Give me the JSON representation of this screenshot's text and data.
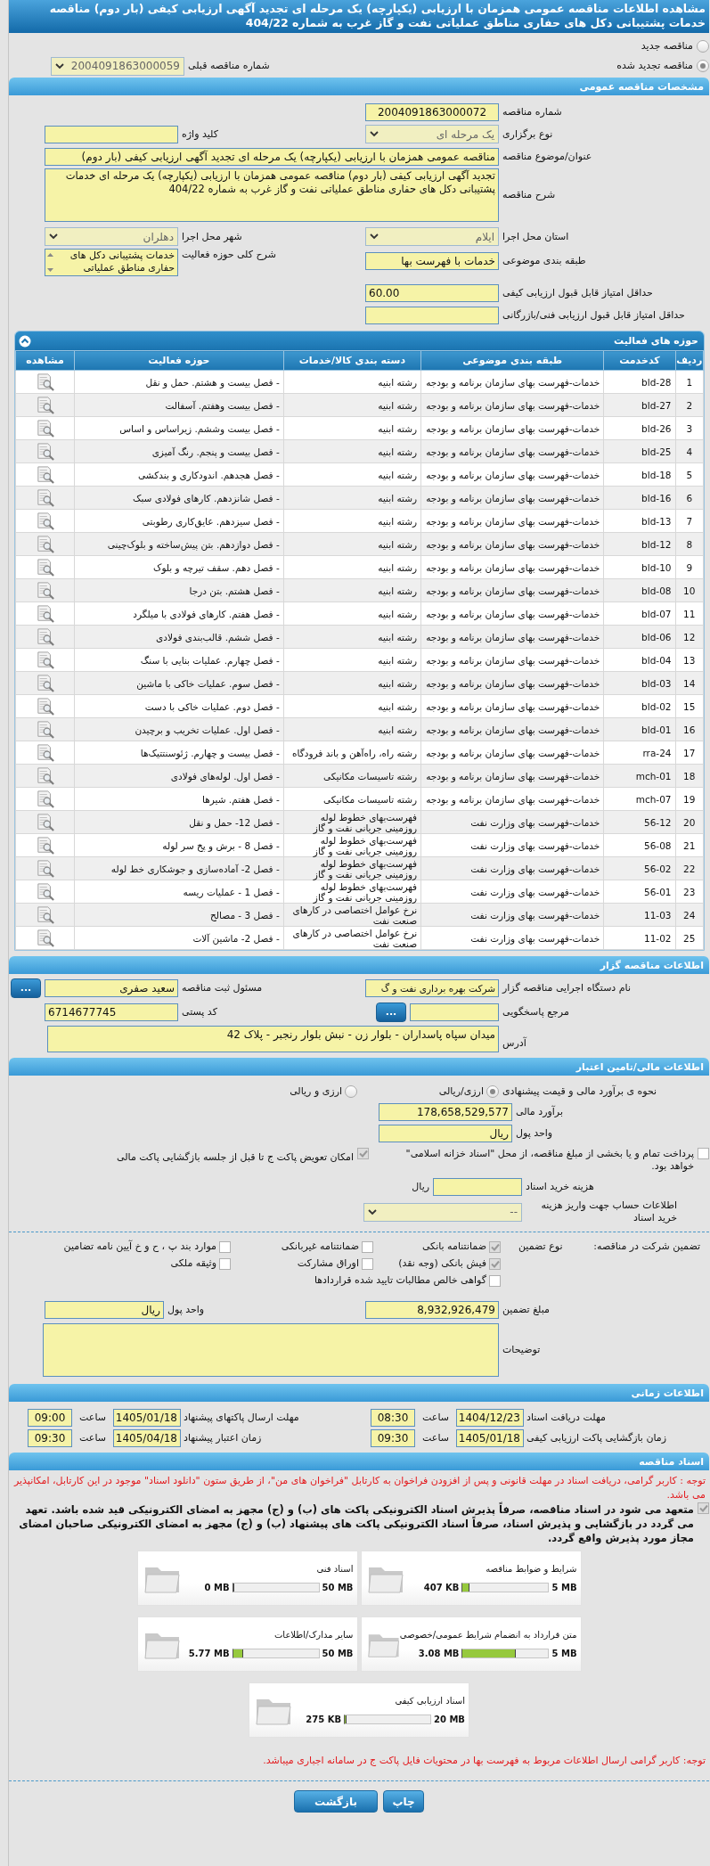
{
  "header": {
    "title": "مشاهده اطلاعات مناقصه عمومی همزمان با ارزیابی (یکپارچه) یک مرحله ای تجدید آگهی ارزیابی کیفی (بار دوم) مناقصه خدمات پشتیبانی دکل های حفاری مناطق عملیاتی نفت و گاز غرب به شماره 404/22"
  },
  "tender_type": [
    {
      "label": "مناقصه جدید",
      "selected": false
    },
    {
      "label": "مناقصه تجدید شده",
      "selected": true
    }
  ],
  "previous_tender": {
    "label": "شماره مناقصه قبلی",
    "value": "2004091863000059"
  },
  "general": {
    "title": "مشخصات مناقصه عمومی",
    "tender_number": {
      "label": "شماره مناقصه",
      "value": "2004091863000072"
    },
    "holding_type": {
      "label": "نوع برگزاری",
      "value": "یک مرحله ای"
    },
    "keyword": {
      "label": "کلید واژه"
    },
    "subject": {
      "label": "عنوان/موضوع مناقصه",
      "value": "مناقصه عمومی همزمان با ارزیابی (یکپارچه) یک مرحله ای تجدید آگهی ارزیابی کیفی (بار دوم)"
    },
    "description": {
      "label": "شرح مناقصه",
      "value": "تجدید آگهی ارزیابی کیفی (بار دوم) مناقصه عمومی همزمان با ارزیابی (یکپارچه) یک مرحله ای خدمات پشتیبانی دکل های حفاری مناطق عملیاتی نفت و گاز غرب به شماره 404/22"
    },
    "province": {
      "label": "استان محل اجرا",
      "value": "ایلام"
    },
    "city": {
      "label": "شهر محل اجرا",
      "value": "دهلران"
    },
    "category": {
      "label": "طبقه بندی موضوعی",
      "value": "خدمات با فهرست بها"
    },
    "activity_scope": {
      "label": "شرح کلی حوزه فعالیت",
      "value": "خدمات پشتیبانی دکل های حفاری مناطق عملیاتی"
    },
    "min_quality_score": {
      "label": "حداقل امتیاز قابل قبول ارزیابی کیفی",
      "value": "60.00"
    },
    "min_technical_score": {
      "label": "حداقل امتیاز قابل قبول ارزیابی فنی/بازرگانی"
    }
  },
  "activities": {
    "title": "حوزه های فعالیت",
    "columns": [
      "ردیف",
      "کدخدمت",
      "طبقه بندی موضوعی",
      "دسته بندی کالا/خدمات",
      "حوزه فعالیت",
      "مشاهده"
    ],
    "rows": [
      {
        "index": "1",
        "code": "bld-28",
        "category": "خدمات-فهرست بهای سازمان برنامه و بودجه",
        "group": "رشته ابنیه",
        "scope": "- فصل بیست و هشتم. حمل و نقل"
      },
      {
        "index": "2",
        "code": "bld-27",
        "category": "خدمات-فهرست بهای سازمان برنامه و بودجه",
        "group": "رشته ابنیه",
        "scope": "- فصل بیست وهفتم. آسفالت"
      },
      {
        "index": "3",
        "code": "bld-26",
        "category": "خدمات-فهرست بهای سازمان برنامه و بودجه",
        "group": "رشته ابنیه",
        "scope": "- فصل بیست وششم. زیراساس و اساس"
      },
      {
        "index": "4",
        "code": "bld-25",
        "category": "خدمات-فهرست بهای سازمان برنامه و بودجه",
        "group": "رشته ابنیه",
        "scope": "- فصل بیست و پنجم. رنگ آمیزی"
      },
      {
        "index": "5",
        "code": "bld-18",
        "category": "خدمات-فهرست بهای سازمان برنامه و بودجه",
        "group": "رشته ابنیه",
        "scope": "- فصل هجدهم. اندودکاری و بندکشی"
      },
      {
        "index": "6",
        "code": "bld-16",
        "category": "خدمات-فهرست بهای سازمان برنامه و بودجه",
        "group": "رشته ابنیه",
        "scope": "- فصل شانزدهم. کارهای فولادی سبک"
      },
      {
        "index": "7",
        "code": "bld-13",
        "category": "خدمات-فهرست بهای سازمان برنامه و بودجه",
        "group": "رشته ابنیه",
        "scope": "- فصل سیزدهم. عایق‌کاری رطوبتی"
      },
      {
        "index": "8",
        "code": "bld-12",
        "category": "خدمات-فهرست بهای سازمان برنامه و بودجه",
        "group": "رشته ابنیه",
        "scope": "- فصل دوازدهم. بتن پیش‌ساخته و بلوک‌چینی"
      },
      {
        "index": "9",
        "code": "bld-10",
        "category": "خدمات-فهرست بهای سازمان برنامه و بودجه",
        "group": "رشته ابنیه",
        "scope": "- فصل دهم. سقف تیرچه و بلوک"
      },
      {
        "index": "10",
        "code": "bld-08",
        "category": "خدمات-فهرست بهای سازمان برنامه و بودجه",
        "group": "رشته ابنیه",
        "scope": "- فصل هشتم. بتن درجا"
      },
      {
        "index": "11",
        "code": "bld-07",
        "category": "خدمات-فهرست بهای سازمان برنامه و بودجه",
        "group": "رشته ابنیه",
        "scope": "- فصل هفتم. کارهای فولادی با میلگرد"
      },
      {
        "index": "12",
        "code": "bld-06",
        "category": "خدمات-فهرست بهای سازمان برنامه و بودجه",
        "group": "رشته ابنیه",
        "scope": "- فصل ششم. قالب‌بندی فولادی"
      },
      {
        "index": "13",
        "code": "bld-04",
        "category": "خدمات-فهرست بهای سازمان برنامه و بودجه",
        "group": "رشته ابنیه",
        "scope": "- فصل چهارم. عملیات بنایی با سنگ"
      },
      {
        "index": "14",
        "code": "bld-03",
        "category": "خدمات-فهرست بهای سازمان برنامه و بودجه",
        "group": "رشته ابنیه",
        "scope": "- فصل سوم. عملیات خاکی با ماشین"
      },
      {
        "index": "15",
        "code": "bld-02",
        "category": "خدمات-فهرست بهای سازمان برنامه و بودجه",
        "group": "رشته ابنیه",
        "scope": "- فصل دوم. عملیات خاکی با دست"
      },
      {
        "index": "16",
        "code": "bld-01",
        "category": "خدمات-فهرست بهای سازمان برنامه و بودجه",
        "group": "رشته ابنیه",
        "scope": "- فصل اول. عملیات تخریب و برچیدن"
      },
      {
        "index": "17",
        "code": "rra-24",
        "category": "خدمات-فهرست بهای سازمان برنامه و بودجه",
        "group": "رشته راه، راه‌آهن و باند فرودگاه",
        "scope": "- فصل بیست و چهارم. ژئوسنتتیک‌ها"
      },
      {
        "index": "18",
        "code": "mch-01",
        "category": "خدمات-فهرست بهای سازمان برنامه و بودجه",
        "group": "رشته تاسیسات مکانیکی",
        "scope": "- فصل اول. لوله‌های فولادی"
      },
      {
        "index": "19",
        "code": "mch-07",
        "category": "خدمات-فهرست بهای سازمان برنامه و بودجه",
        "group": "رشته تاسیسات مکانیکی",
        "scope": "- فصل هفتم. شیرها"
      },
      {
        "index": "20",
        "code": "56-12",
        "category": "خدمات-فهرست بهای وزارت نفت",
        "group": "فهرست‌بهای خطوط لوله روزمینی جریانی نفت و گاز",
        "scope": "- فصل 12- حمل و نقل"
      },
      {
        "index": "21",
        "code": "56-08",
        "category": "خدمات-فهرست بهای وزارت نفت",
        "group": "فهرست‌بهای خطوط لوله روزمینی جریانی نفت و گاز",
        "scope": "- فصل 8 - برش و پخ سر لوله"
      },
      {
        "index": "22",
        "code": "56-02",
        "category": "خدمات-فهرست بهای وزارت نفت",
        "group": "فهرست‌بهای خطوط لوله روزمینی جریانی نفت و گاز",
        "scope": "- فصل 2- آماده‌سازی و جوشکاری خط لوله"
      },
      {
        "index": "23",
        "code": "56-01",
        "category": "خدمات-فهرست بهای وزارت نفت",
        "group": "فهرست‌بهای خطوط لوله روزمینی جریانی نفت و گاز",
        "scope": "- فصل 1 - عملیات ریسه"
      },
      {
        "index": "24",
        "code": "11-03",
        "category": "خدمات-فهرست بهای وزارت نفت",
        "group": "نرخ عوامل اختصاصی در کارهای صنعت نفت",
        "scope": "- فصل 3 - مصالح"
      },
      {
        "index": "25",
        "code": "11-02",
        "category": "خدمات-فهرست بهای وزارت نفت",
        "group": "نرخ عوامل اختصاصی در کارهای صنعت نفت",
        "scope": "- فصل 2- ماشین آلات"
      }
    ]
  },
  "contractor": {
    "title": "اطلاعات مناقصه گزار",
    "organization": {
      "label": "نام دستگاه اجرایی مناقصه گزار",
      "value": "شرکت بهره برداری نفت و گ"
    },
    "registrar": {
      "label": "مسئول ثبت مناقصه",
      "value": "سعید صفری",
      "button": "..."
    },
    "reference": {
      "label": "مرجع پاسخگویی",
      "button": "..."
    },
    "postal_code": {
      "label": "کد پستی",
      "value": "6714677745"
    },
    "address": {
      "label": "آدرس",
      "value": "میدان سپاه پاسداران - بلوار زن - نبش بلوار رنجبر - پلاک 42"
    }
  },
  "financial": {
    "title": "اطلاعات مالی/تامین اعتبار",
    "estimate_mode": {
      "label": "نحوه ی برآورد مالی و قیمت پیشنهادی",
      "options": [
        {
          "label": "ارزی/ریالی",
          "selected": true
        },
        {
          "label": "ارزی و ریالی",
          "selected": false
        }
      ]
    },
    "estimate": {
      "label": "برآورد مالی",
      "value": "178,658,529,577"
    },
    "currency": {
      "label": "واحد پول",
      "value": "ریال"
    },
    "treasury": {
      "label": "پرداخت تمام و یا بخشی از مبلغ مناقصه، از محل \"اسناد خزانه اسلامی\" خواهد بود.",
      "checked": false
    },
    "envelope_swap": {
      "label": "امکان تعویض پاکت ج تا قبل از جلسه بازگشایی پاکت مالی",
      "checked": true
    },
    "document_fee": {
      "label": "هزینه خرید اسناد",
      "unit": "ریال"
    },
    "account": {
      "label": "اطلاعات حساب جهت واریز هزینه خرید اسناد",
      "value": "--"
    }
  },
  "guarantee": {
    "label": "تضمین شرکت در مناقصه:",
    "type_label": "نوع تضمین",
    "options": [
      {
        "label": "ضمانتنامه بانکی",
        "checked": true
      },
      {
        "label": "ضمانتنامه غیربانکی",
        "checked": false
      },
      {
        "label": "موارد بند پ ، ح و خ آیین نامه تضامین",
        "checked": false
      },
      {
        "label": "فیش بانکی (وجه نقد)",
        "checked": true
      },
      {
        "label": "اوراق مشارکت",
        "checked": false
      },
      {
        "label": "وثیقه ملکی",
        "checked": false
      },
      {
        "label": "گواهی خالص مطالبات تایید شده قراردادها",
        "checked": false
      }
    ],
    "amount": {
      "label": "مبلغ تضمین",
      "value": "8,932,926,479"
    },
    "currency": {
      "label": "واحد پول",
      "value": "ریال"
    },
    "notes": {
      "label": "توضیحات"
    }
  },
  "timing": {
    "title": "اطلاعات زمانی",
    "items": [
      {
        "label": "مهلت دریافت اسناد",
        "date": "1404/12/23",
        "time_label": "ساعت",
        "time": "08:30"
      },
      {
        "label": "مهلت ارسال پاکتهای پیشنهاد",
        "date": "1405/01/18",
        "time_label": "ساعت",
        "time": "09:00"
      },
      {
        "label": "زمان بازگشایی پاکت ارزیابی کیفی",
        "date": "1405/01/18",
        "time_label": "ساعت",
        "time": "09:30"
      },
      {
        "label": "زمان اعتبار پیشنهاد",
        "date": "1405/04/18",
        "time_label": "ساعت",
        "time": "09:30"
      }
    ]
  },
  "documents": {
    "title": "اسناد مناقصه",
    "notice": "توجه : کاربر گرامی، دریافت اسناد در مهلت قانونی و پس از افزودن فراخوان به کارتابل \"فراخوان های من\"، از طریق ستون \"دانلود اسناد\" موجود در این کارتابل، امکانپذیر می باشد.",
    "commitment": {
      "text": "متعهد می شود در اسناد مناقصه، صرفاً پذیرش اسناد الکترونیکی پاکت های (ب) و (ج) مجهز به امضای الکترونیکی قید شده باشد. تعهد می گردد در بازگشایی و پذیرش اسناد، صرفاً اسناد الکترونیکی پاکت های پیشنهاد (ب) و (ج) مجهز به امضای الکترونیکی صاحبان امضای مجاز مورد پذیرش واقع گردد.",
      "checked": true
    },
    "files": [
      {
        "name": "شرایط و ضوابط مناقصه",
        "size": "407 KB",
        "max": "5 MB",
        "level": 0.08
      },
      {
        "name": "اسناد فنی",
        "size": "0 MB",
        "max": "50 MB",
        "level": 0
      },
      {
        "name": "متن قرارداد به انضمام شرایط عمومی/خصوصی",
        "size": "3.08 MB",
        "max": "5 MB",
        "level": 0.62
      },
      {
        "name": "سایر مدارک/اطلاعات",
        "size": "5.77 MB",
        "max": "50 MB",
        "level": 0.12
      },
      {
        "name": "اسناد ارزیابی کیفی",
        "size": "275 KB",
        "max": "20 MB",
        "level": 0.02
      }
    ],
    "footer_note": "توجه: کاربر گرامی ارسال اطلاعات مربوط به فهرست بها در محتویات فایل پاکت ج در سامانه اجباری میباشد."
  },
  "buttons": [
    {
      "kind": "print",
      "label": "چاپ"
    },
    {
      "kind": "back",
      "label": "بازگشت"
    }
  ]
}
